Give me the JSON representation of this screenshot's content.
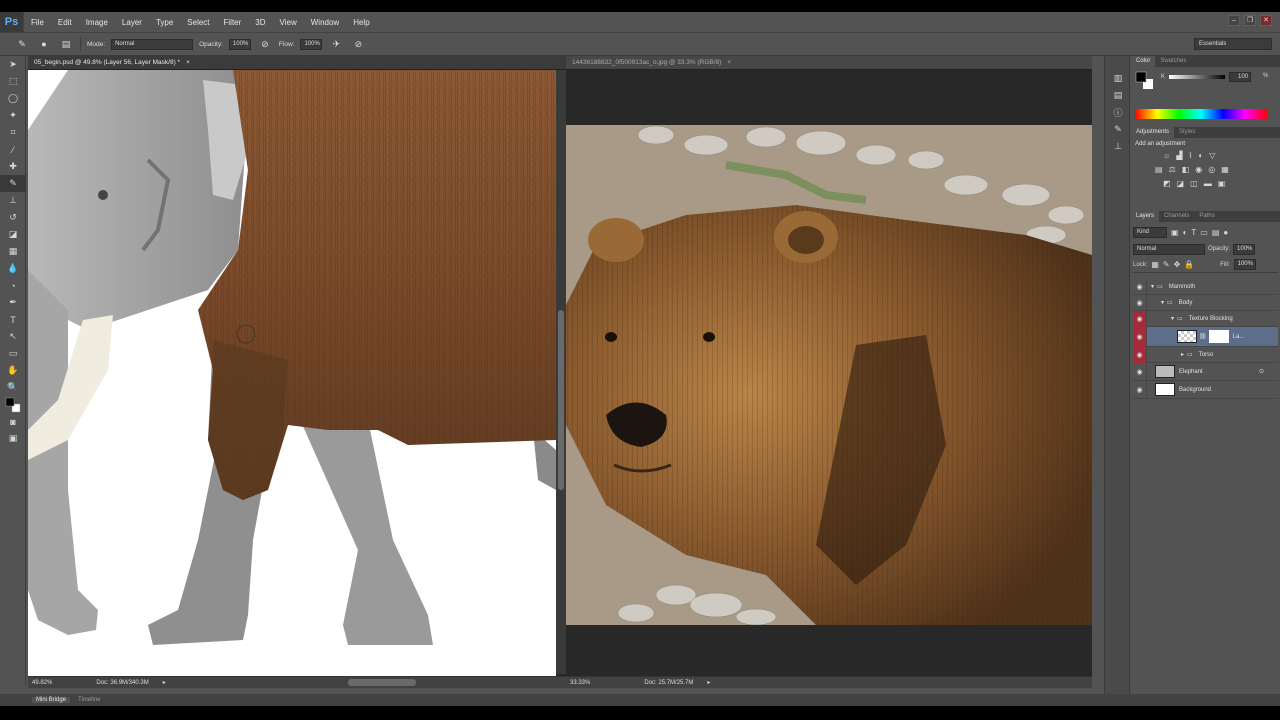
{
  "app": {
    "logo": "Ps"
  },
  "menu": [
    "File",
    "Edit",
    "Image",
    "Layer",
    "Type",
    "Select",
    "Filter",
    "3D",
    "View",
    "Window",
    "Help"
  ],
  "window_controls": [
    "–",
    "❐",
    "✕"
  ],
  "options": {
    "mode_label": "Mode:",
    "mode_value": "Normal",
    "opacity_label": "Opacity:",
    "opacity_value": "100%",
    "flow_label": "Flow:",
    "flow_value": "100%",
    "workspace": "Essentials"
  },
  "doc1": {
    "tab": "05_begin.psd @ 49.8% (Layer 56, Layer Mask/8) *",
    "zoom": "49.82%",
    "docsize": "Doc: 36.9M/340.3M"
  },
  "doc2": {
    "tab": "14436188832_0f500913ac_o.jpg @ 33.3% (RGB/8)",
    "zoom": "33.33%",
    "docsize": "Doc: 25.7M/25.7M"
  },
  "color_panel": {
    "tabs": [
      "Color",
      "Swatches"
    ],
    "k_label": "K",
    "k_value": "100",
    "unit": "%"
  },
  "adjustments_panel": {
    "tabs": [
      "Adjustments",
      "Styles"
    ],
    "heading": "Add an adjustment"
  },
  "layers_panel": {
    "tabs": [
      "Layers",
      "Channels",
      "Paths"
    ],
    "kind": "Kind",
    "blend": "Normal",
    "opacity_label": "Opacity:",
    "opacity_value": "100%",
    "lock_label": "Lock:",
    "fill_label": "Fill:",
    "fill_value": "100%",
    "layers": [
      {
        "name": "Mammoth",
        "indent": 0,
        "eye_red": false
      },
      {
        "name": "Body",
        "indent": 1,
        "eye_red": false
      },
      {
        "name": "Texture Blocking",
        "indent": 2,
        "eye_red": true
      },
      {
        "name": "La...",
        "indent": 3,
        "eye_red": true,
        "selected": true
      },
      {
        "name": "Torso",
        "indent": 3,
        "eye_red": true
      },
      {
        "name": "Elephant",
        "indent": 0,
        "eye_red": false
      },
      {
        "name": "Background",
        "indent": 0,
        "eye_red": false
      }
    ]
  },
  "bottom_tabs": [
    "Mini Bridge",
    "Timeline"
  ]
}
